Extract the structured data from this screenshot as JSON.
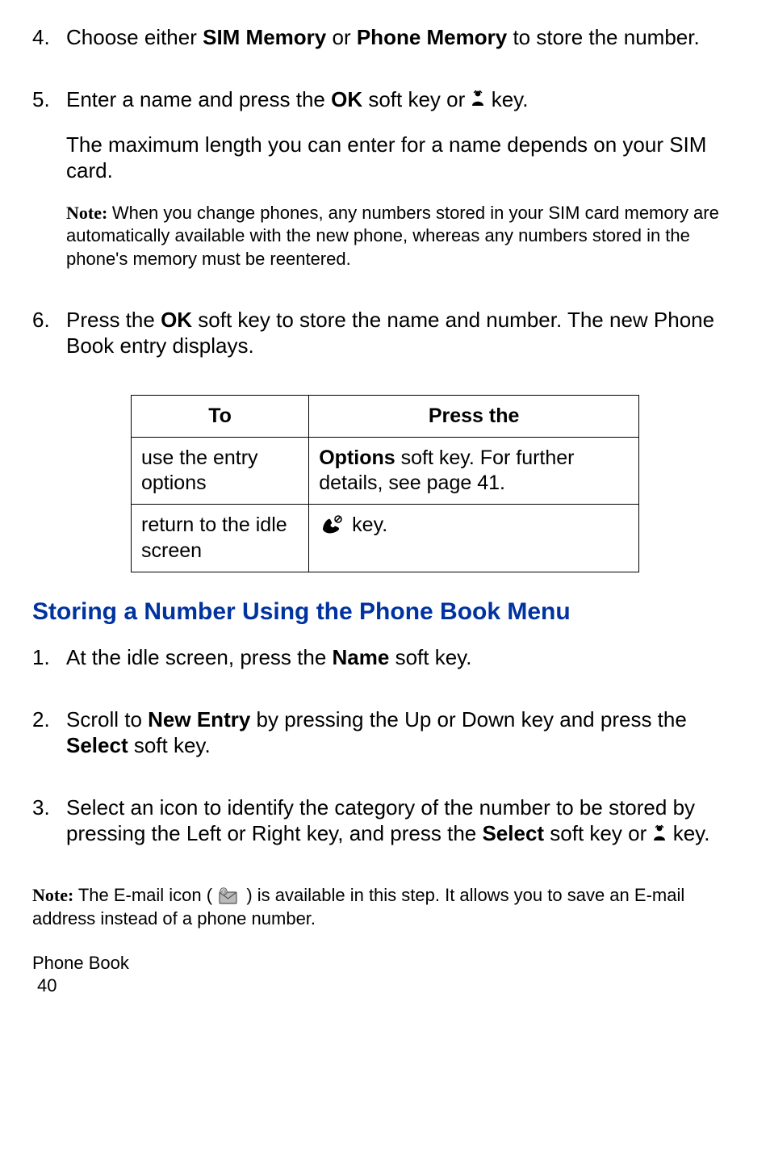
{
  "steps_a": {
    "s4": {
      "num": "4.",
      "pre": "Choose either ",
      "b1": "SIM Memory",
      "mid": " or ",
      "b2": "Phone Memory",
      "post": " to store the number."
    },
    "s5": {
      "num": "5.",
      "pre": "Enter a name and press the ",
      "b1": "OK",
      "mid": " soft key or ",
      "post": " key."
    },
    "s5_cont": "The maximum length you can enter for a name depends on your SIM card.",
    "note": {
      "label": "Note: ",
      "body": "When you change phones, any numbers stored in your SIM card memory are automatically available with the new phone, whereas any numbers stored in the phone's memory must be reentered."
    },
    "s6": {
      "num": "6.",
      "pre": "Press the ",
      "b1": "OK",
      "post": " soft key to store the name and number. The new Phone Book entry displays."
    }
  },
  "table": {
    "head_to": "To",
    "head_press": "Press the",
    "r1_to": "use the entry options",
    "r1_press_b": "Options",
    "r1_press_rest": " soft key. For further details, see page 41.",
    "r2_to": "return to the idle screen",
    "r2_press_post": " key."
  },
  "section_heading": "Storing a Number Using the Phone Book Menu",
  "steps_b": {
    "s1": {
      "num": "1.",
      "pre": "At the idle screen, press the ",
      "b1": "Name",
      "post": " soft key."
    },
    "s2": {
      "num": "2.",
      "pre": "Scroll to ",
      "b1": "New Entry",
      "mid": " by pressing the Up or Down key and press the ",
      "b2": "Select",
      "post": " soft key."
    },
    "s3": {
      "num": "3.",
      "pre": "Select an icon to identify the category of the number to be stored by pressing the Left or Right key, and press the ",
      "b1": "Select",
      "mid": " soft key or ",
      "post": " key."
    }
  },
  "footer_note": {
    "label": "Note: ",
    "pre": "The E-mail icon ( ",
    "post": " ) is available in this step. It allows you to save an E-mail address instead of a phone number."
  },
  "running_footer": "Phone Book",
  "page_number": "40"
}
